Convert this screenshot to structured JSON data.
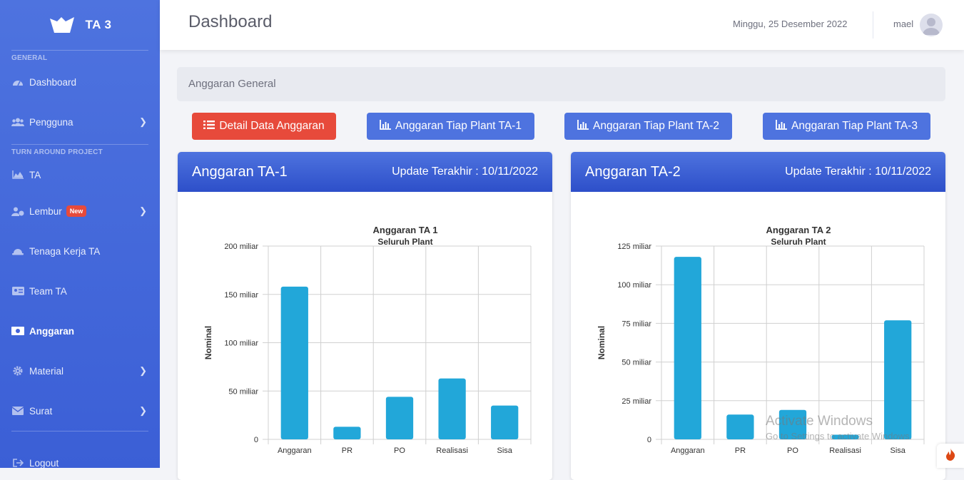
{
  "sidebar": {
    "brand": "TA 3",
    "heading_general": "GENERAL",
    "heading_project": "TURN AROUND PROJECT",
    "items": {
      "dashboard": "Dashboard",
      "pengguna": "Pengguna",
      "ta": "TA",
      "lembur": "Lembur",
      "lembur_badge": "New",
      "tenaga": "Tenaga Kerja TA",
      "team": "Team TA",
      "anggaran": "Anggaran",
      "material": "Material",
      "surat": "Surat",
      "logout": "Logout"
    }
  },
  "topbar": {
    "title": "Dashboard",
    "date": "Minggu, 25 Desember 2022",
    "user": "mael"
  },
  "breadcrumb": "Anggaran General",
  "buttons": {
    "detail": "Detail Data Anggaran",
    "plant1": "Anggaran Tiap Plant TA-1",
    "plant2": "Anggaran Tiap Plant TA-2",
    "plant3": "Anggaran Tiap Plant TA-3"
  },
  "cards": [
    {
      "title": "Anggaran TA-1",
      "updated": "Update Terakhir : 10/11/2022"
    },
    {
      "title": "Anggaran TA-2",
      "updated": "Update Terakhir : 10/11/2022"
    }
  ],
  "colors": {
    "primary": "#4e73df",
    "danger": "#e74a3b",
    "bar": "#22a7d9"
  },
  "watermark": {
    "line1": "Activate Windows",
    "line2": "Go to Settings to activate Windows."
  },
  "chart_data": [
    {
      "type": "bar",
      "title": "Anggaran TA 1",
      "subtitle": "Seluruh Plant",
      "ylabel": "Nominal",
      "categories": [
        "Anggaran",
        "PR",
        "PO",
        "Realisasi",
        "Sisa"
      ],
      "values": [
        158,
        13,
        44,
        63,
        35
      ],
      "ylim": [
        0,
        200
      ],
      "yticks": [
        0,
        50,
        100,
        150,
        200
      ],
      "ytick_labels": [
        "0",
        "50 miliar",
        "100 miliar",
        "150 miliar",
        "200 miliar"
      ],
      "unit": "miliar",
      "grid": true
    },
    {
      "type": "bar",
      "title": "Anggaran TA 2",
      "subtitle": "Seluruh Plant",
      "ylabel": "Nominal",
      "categories": [
        "Anggaran",
        "PR",
        "PO",
        "Realisasi",
        "Sisa"
      ],
      "values": [
        118,
        16,
        19,
        3,
        77
      ],
      "ylim": [
        0,
        125
      ],
      "yticks": [
        0,
        25,
        50,
        75,
        100,
        125
      ],
      "ytick_labels": [
        "0",
        "25 miliar",
        "50 miliar",
        "75 miliar",
        "100 miliar",
        "125 miliar"
      ],
      "unit": "miliar",
      "grid": true
    }
  ]
}
